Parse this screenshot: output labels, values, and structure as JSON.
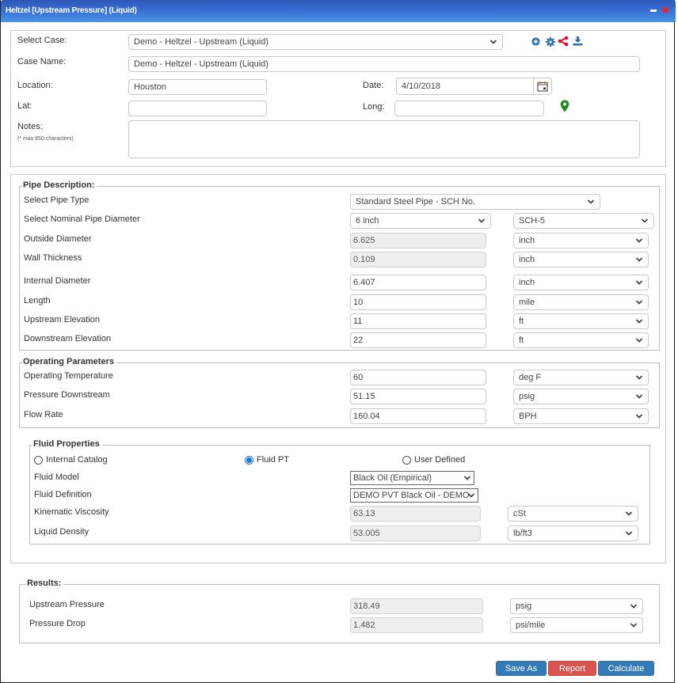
{
  "window": {
    "title": "Heltzel [Upstream Pressure] (Liquid)",
    "minimize_icon": "minimize-icon",
    "close_icon": "close-icon",
    "close_glyph": "✖"
  },
  "case": {
    "select_case_label": "Select Case:",
    "select_case_value": "Demo - Heltzel - Upstream (Liquid)",
    "case_name_label": "Case Name:",
    "case_name_value": "Demo - Heltzel - Upstream (Liquid)",
    "location_label": "Location:",
    "location_value": "Houston",
    "date_label": "Date:",
    "date_value": "4/10/2018",
    "lat_label": "Lat:",
    "lat_value": "",
    "long_label": "Long:",
    "long_value": "",
    "notes_label": "Notes:",
    "notes_hint": "(* max 850 characters)",
    "notes_value": "",
    "toolbar_icons": [
      "add-icon",
      "settings-icon",
      "share-icon",
      "download-icon"
    ],
    "colors": {
      "toolbar_icon": "#2a6db5",
      "share_icon": "#e8112d",
      "map_pin": "#1b8a1b"
    }
  },
  "pipe_description": {
    "legend": "Pipe Description:",
    "pipe_type_label": "Select Pipe Type",
    "pipe_type_value": "Standard Steel Pipe - SCH No.",
    "nominal_label": "Select Nominal Pipe Diameter",
    "nominal_value": "6 inch",
    "schedule_value": "SCH-5",
    "rows": [
      {
        "label": "Outside Diameter",
        "value": "6.625",
        "unit": "inch",
        "readonly": true
      },
      {
        "label": "Wall Thickness",
        "value": "0.109",
        "unit": "inch",
        "readonly": true
      },
      {
        "label": "Internal Diameter",
        "value": "6.407",
        "unit": "inch",
        "readonly": false
      },
      {
        "label": "Length",
        "value": "10",
        "unit": "mile",
        "readonly": false
      },
      {
        "label": "Upstream Elevation",
        "value": "11",
        "unit": "ft",
        "readonly": false
      },
      {
        "label": "Downstream Elevation",
        "value": "22",
        "unit": "ft",
        "readonly": false
      }
    ]
  },
  "operating_parameters": {
    "legend": "Operating Parameters",
    "rows": [
      {
        "label": "Operating Temperature",
        "value": "60",
        "unit": "deg F"
      },
      {
        "label": "Pressure Downstream",
        "value": "51.15",
        "unit": "psig"
      },
      {
        "label": "Flow Rate",
        "value": "160.04",
        "unit": "BPH"
      }
    ]
  },
  "fluid_properties": {
    "legend": "Fluid Properties",
    "radio_options": [
      {
        "label": "Internal Catalog",
        "selected": false
      },
      {
        "label": "Fluid PT",
        "selected": true
      },
      {
        "label": "User Defined",
        "selected": false
      }
    ],
    "fluid_model_label": "Fluid Model",
    "fluid_model_value": "Black Oil (Empirical)",
    "fluid_definition_label": "Fluid Definition",
    "fluid_definition_value": "DEMO PVT Black Oil - DEMO",
    "rows": [
      {
        "label": "Kinematic Viscosity",
        "value": "63.13",
        "unit": "cSt"
      },
      {
        "label": "Liquid Density",
        "value": "53.005",
        "unit": "lb/ft3"
      }
    ]
  },
  "results": {
    "legend": "Results:",
    "rows": [
      {
        "label": "Upstream Pressure",
        "value": "318.49",
        "unit": "psig"
      },
      {
        "label": "Pressure Drop",
        "value": "1.482",
        "unit": "psi/mile"
      }
    ]
  },
  "actions": {
    "save_as": "Save As",
    "report": "Report",
    "calculate": "Calculate",
    "colors": {
      "primary": "#337ab7",
      "danger": "#d9534f"
    }
  }
}
